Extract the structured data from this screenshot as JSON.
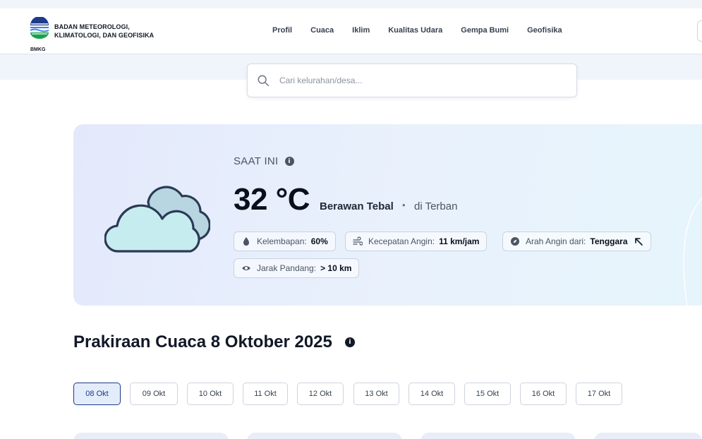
{
  "header": {
    "logo_text": "BMKG",
    "brand_line1": "BADAN METEOROLOGI,",
    "brand_line2": "KLIMATOLOGI, DAN GEOFISIKA",
    "nav": [
      "Profil",
      "Cuaca",
      "Iklim",
      "Kualitas Udara",
      "Gempa Bumi",
      "Geofisika"
    ]
  },
  "search": {
    "placeholder": "Cari kelurahan/desa..."
  },
  "current": {
    "label": "SAAT INI",
    "temperature": "32 °C",
    "condition": "Berawan Tebal",
    "separator": "•",
    "location": "di Terban",
    "humidity": {
      "label": "Kelembapan:",
      "value": "60%"
    },
    "wind_speed": {
      "label": "Kecepatan Angin:",
      "value": "11 km/jam"
    },
    "wind_direction": {
      "label": "Arah Angin dari:",
      "value": "Tenggara"
    },
    "visibility": {
      "label": "Jarak Pandang:",
      "value": "> 10 km"
    }
  },
  "forecast": {
    "title": "Prakiraan Cuaca 8 Oktober 2025",
    "dates": [
      "08 Okt",
      "09 Okt",
      "10 Okt",
      "11 Okt",
      "12 Okt",
      "13 Okt",
      "14 Okt",
      "15 Okt",
      "16 Okt",
      "17 Okt"
    ],
    "selected_index": 0
  },
  "colors": {
    "accent": "#1e3a8a",
    "card_bg": "#e6eefb",
    "text": "#111827"
  }
}
